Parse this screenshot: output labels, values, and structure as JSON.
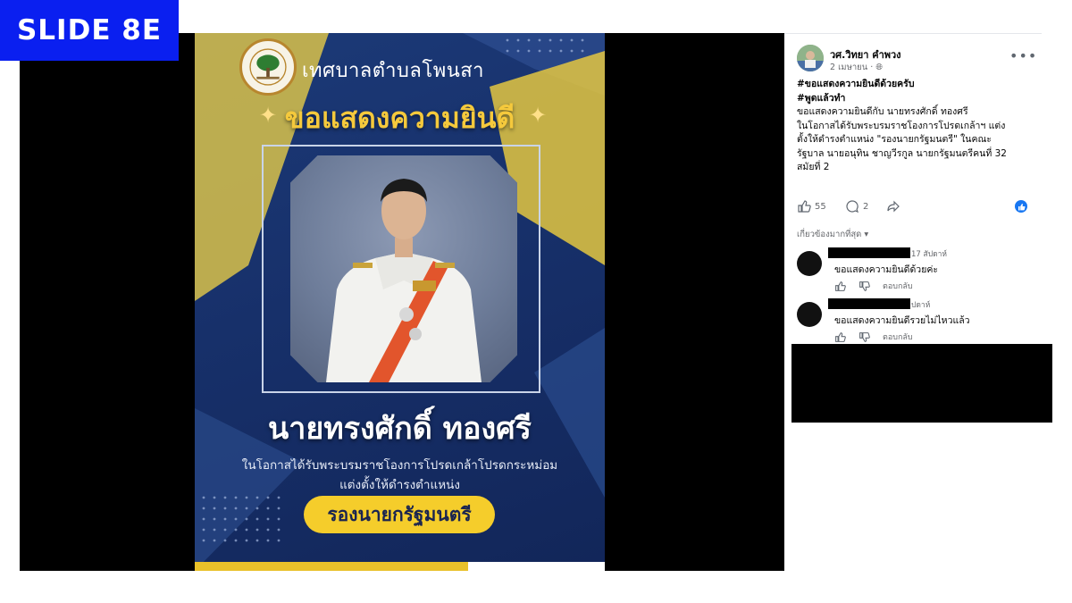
{
  "slide_label": "SLIDE 8E",
  "poster": {
    "org_name": "เทศบาลตำบลโพนสา",
    "headline": "ขอแสดงความยินดี",
    "name": "นายทรงศักดิ์ ทองศรี",
    "occasion_line1": "ในโอกาสได้รับพระบรมราชโองการโปรดเกล้าโปรดกระหม่อม",
    "occasion_line2": "แต่งตั้งให้ดำรงตำแหน่ง",
    "position": "รองนายกรัฐมนตรี",
    "colors": {
      "background": "#17306a",
      "gold": "#f5c93c",
      "pill": "#f5cd2b"
    }
  },
  "post": {
    "author": "วศ.วิทยา คำพวง",
    "date": "2 เมษายน",
    "privacy_icon": "globe-icon",
    "text": {
      "hashtag1": "#ขอแสดงความยินดีด้วยครับ",
      "hashtag2": "#พูดแล้วทำ",
      "line1": "ขอแสดงความยินดีกับ นายทรงศักดิ์ ทองศรี",
      "line2": "ในโอกาสได้รับพระบรมราชโองการโปรดเกล้าฯ แต่ง",
      "line3": "ตั้งให้ดำรงตำแหน่ง \"รองนายกรัฐมนตรี\" ในคณะ",
      "line4": "รัฐบาล นายอนุทิน ชาญวีรกูล นายกรัฐมนตรีคนที่ 32",
      "line5": "สมัยที่ 2"
    },
    "likes": "55",
    "comments_count": "2",
    "sort_label": "เกี่ยวข้องมากที่สุด",
    "comments": [
      {
        "time": "17 สัปดาห์",
        "text": "ขอแสดงความยินดีด้วยค่ะ",
        "reply_label": "ตอบกลับ"
      },
      {
        "time": "ปดาห์",
        "text": "ขอแสดงความยินดีรวยไม่ไหวแล้ว",
        "reply_label": "ตอบกลับ"
      }
    ]
  }
}
